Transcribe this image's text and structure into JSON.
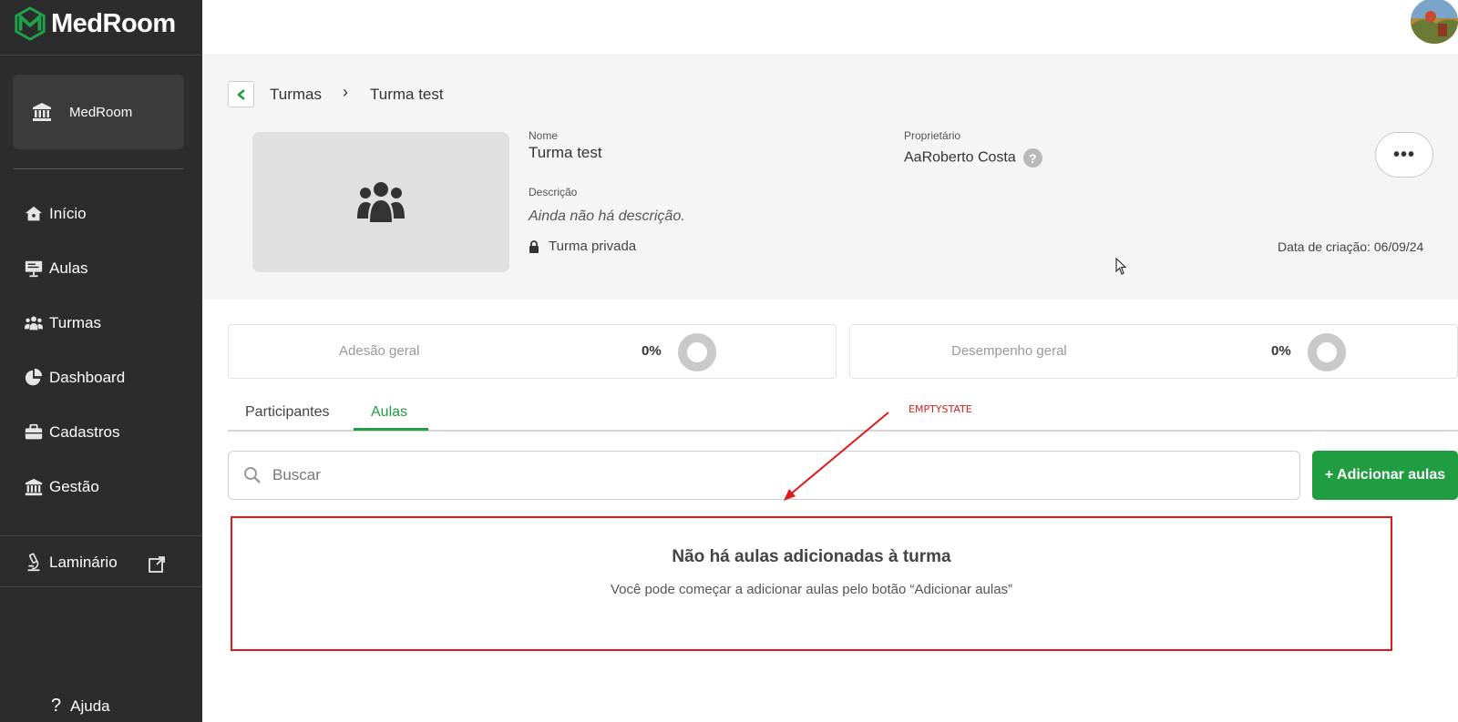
{
  "app": {
    "brand": "MedRoom"
  },
  "sidebar": {
    "org_name": "MedRoom",
    "items": [
      {
        "label": "Início",
        "icon": "home-icon"
      },
      {
        "label": "Aulas",
        "icon": "presentation-icon"
      },
      {
        "label": "Turmas",
        "icon": "users-icon"
      },
      {
        "label": "Dashboard",
        "icon": "pie-chart-icon"
      },
      {
        "label": "Cadastros",
        "icon": "briefcase-icon"
      },
      {
        "label": "Gestão",
        "icon": "institution-icon"
      },
      {
        "label": "Laminário",
        "icon": "microscope-icon"
      }
    ],
    "help_label": "Ajuda"
  },
  "breadcrumb": {
    "parent": "Turmas",
    "separator": "›",
    "current": "Turma test"
  },
  "class": {
    "name_label": "Nome",
    "name": "Turma test",
    "description_label": "Descrição",
    "description": "Ainda não há descrição.",
    "privacy": "Turma privada",
    "owner_label": "Proprietário",
    "owner": "AaRoberto Costa",
    "owner_help": "?",
    "created": "Data de criação: 06/09/24",
    "more": "•••"
  },
  "stats": {
    "adhesion_label": "Adesão geral",
    "adhesion_value": "0%",
    "adhesion_fraction": 0,
    "performance_label": "Desempenho geral",
    "performance_value": "0%",
    "performance_fraction": 0
  },
  "tabs": [
    {
      "label": "Participantes",
      "active": false
    },
    {
      "label": "Aulas",
      "active": true
    }
  ],
  "search": {
    "placeholder": "Buscar",
    "value": ""
  },
  "add_button": "+ Adicionar aulas",
  "empty_state": {
    "title": "Não há aulas adicionadas à turma",
    "subtitle": "Você pode começar a adicionar aulas pelo botão “Adicionar aulas”"
  },
  "annotation": "EMPTYSTATE",
  "colors": {
    "sidebar": "#2c2c2c",
    "accent": "#1f9d40",
    "annotation": "#e11919"
  }
}
